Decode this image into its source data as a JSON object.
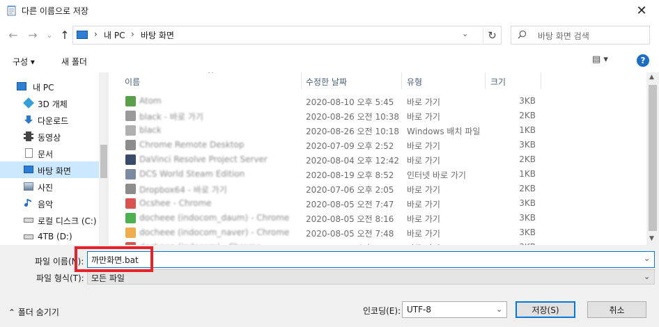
{
  "window": {
    "title": "다른 이름으로 저장",
    "close": "✕"
  },
  "address": {
    "back": "←",
    "forward": "→",
    "recent": "⌄",
    "up": "↑",
    "sep": "›",
    "crumbs": [
      "내 PC",
      "바탕 화면"
    ],
    "dropdown": "⌄",
    "refresh": "↻"
  },
  "search": {
    "placeholder": "바탕 화면 검색"
  },
  "toolbar": {
    "organize": "구성 ▾",
    "new_folder": "새 폴더",
    "view": "▤ ▾",
    "help": "?"
  },
  "nav": {
    "items": [
      {
        "label": "내 PC",
        "icon": "pc-icon",
        "color": "#2d7fd3"
      },
      {
        "label": "3D 개체",
        "icon": "cube-icon",
        "color": "#34a0d8"
      },
      {
        "label": "다운로드",
        "icon": "download-icon",
        "color": "#2b78d0"
      },
      {
        "label": "동영상",
        "icon": "film-icon",
        "color": "#555555"
      },
      {
        "label": "문서",
        "icon": "document-icon",
        "color": "#8a8a8a"
      },
      {
        "label": "바탕 화면",
        "icon": "desktop-icon",
        "color": "#2d7fd3"
      },
      {
        "label": "사진",
        "icon": "picture-icon",
        "color": "#6a7f99"
      },
      {
        "label": "음악",
        "icon": "music-icon",
        "color": "#1f6fc5"
      },
      {
        "label": "로컬 디스크 (C:)",
        "icon": "drive-icon",
        "color": "#7a7a7a"
      },
      {
        "label": "4TB (D:)",
        "icon": "drive-icon",
        "color": "#7a7a7a"
      }
    ]
  },
  "columns": {
    "name": "이름",
    "modified": "수정한 날짜",
    "type": "유형",
    "size": "크기",
    "sort": "^"
  },
  "files": [
    {
      "name": "Atom",
      "modified": "2020-08-10 오후 5:45",
      "type": "바로 가기",
      "size": "3KB",
      "color": "#5aa04a"
    },
    {
      "name": "black - 바로 가기",
      "modified": "2020-08-26 오전 10:38",
      "type": "바로 가기",
      "size": "2KB",
      "color": "#9a9a9a"
    },
    {
      "name": "black",
      "modified": "2020-08-26 오전 10:18",
      "type": "Windows 배치 파일",
      "size": "1KB",
      "color": "#b0b0b0"
    },
    {
      "name": "Chrome Remote Desktop",
      "modified": "2020-07-09 오후 2:52",
      "type": "바로 가기",
      "size": "3KB",
      "color": "#8c8c8c"
    },
    {
      "name": "DaVinci Resolve Project Server",
      "modified": "2020-08-04 오후 12:42",
      "type": "바로 가기",
      "size": "2KB",
      "color": "#3a4a6a"
    },
    {
      "name": "DCS World Steam Edition",
      "modified": "2020-08-19 오후 8:52",
      "type": "인터넷 바로 가기",
      "size": "1KB",
      "color": "#7a8aa0"
    },
    {
      "name": "Dropbox64 - 바로 가기",
      "modified": "2020-07-06 오후 2:05",
      "type": "바로 가기",
      "size": "2KB",
      "color": "#8c8c8c"
    },
    {
      "name": "Ocshee - Chrome",
      "modified": "2020-08-05 오전 7:47",
      "type": "바로 가기",
      "size": "3KB",
      "color": "#d9534f"
    },
    {
      "name": "docheee (indocom_daum) - Chrome",
      "modified": "2020-08-05 오전 8:16",
      "type": "바로 가기",
      "size": "3KB",
      "color": "#4caf50"
    },
    {
      "name": "docheee (indocom_naver) - Chrome",
      "modified": "2020-08-05 오전 7:48",
      "type": "바로 가기",
      "size": "3KB",
      "color": "#f0ad4e"
    },
    {
      "name": "docheee (indocom) - Chrome",
      "modified": "2020-08-11 오후 1:53",
      "type": "바로 가기",
      "size": "3KB",
      "color": "#d9534f"
    }
  ],
  "bottom": {
    "filename_label": "파일 이름(N):",
    "filename_value": "까만화면.bat",
    "filetype_label": "파일 형식(T):",
    "filetype_value": "모든 파일",
    "hide_folders": "⌃  폴더 숨기기",
    "encoding_label": "인코딩(E):",
    "encoding_value": "UTF-8",
    "save": "저장(S)",
    "cancel": "취소",
    "dropdown": "⌄"
  },
  "highlight_color": "#e8212b"
}
